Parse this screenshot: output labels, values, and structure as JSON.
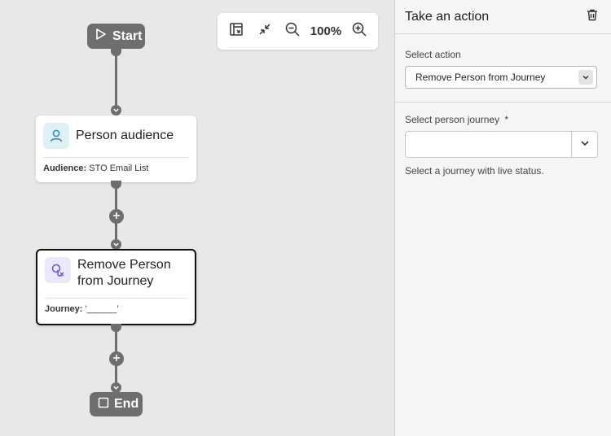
{
  "flow": {
    "start_label": "Start",
    "end_label": "End",
    "nodes": [
      {
        "title": "Person audience",
        "footer_key": "Audience:",
        "footer_value": "STO Email List"
      },
      {
        "title": "Remove Person from Journey",
        "footer_key": "Journey:",
        "footer_value": "'______'"
      }
    ]
  },
  "toolbar": {
    "zoom_level": "100%"
  },
  "panel": {
    "title": "Take an action",
    "select_action_label": "Select action",
    "select_action_value": "Remove Person from Journey",
    "journey_label": "Select person journey",
    "journey_required": "*",
    "journey_value": "",
    "journey_help": "Select a journey with live status."
  },
  "colors": {
    "connector": "#6e6e6e",
    "audience_icon_bg": "#dff0f7",
    "audience_icon": "#2b8bb5",
    "action_icon_bg": "#ece8fb",
    "action_icon": "#6a55c8"
  }
}
